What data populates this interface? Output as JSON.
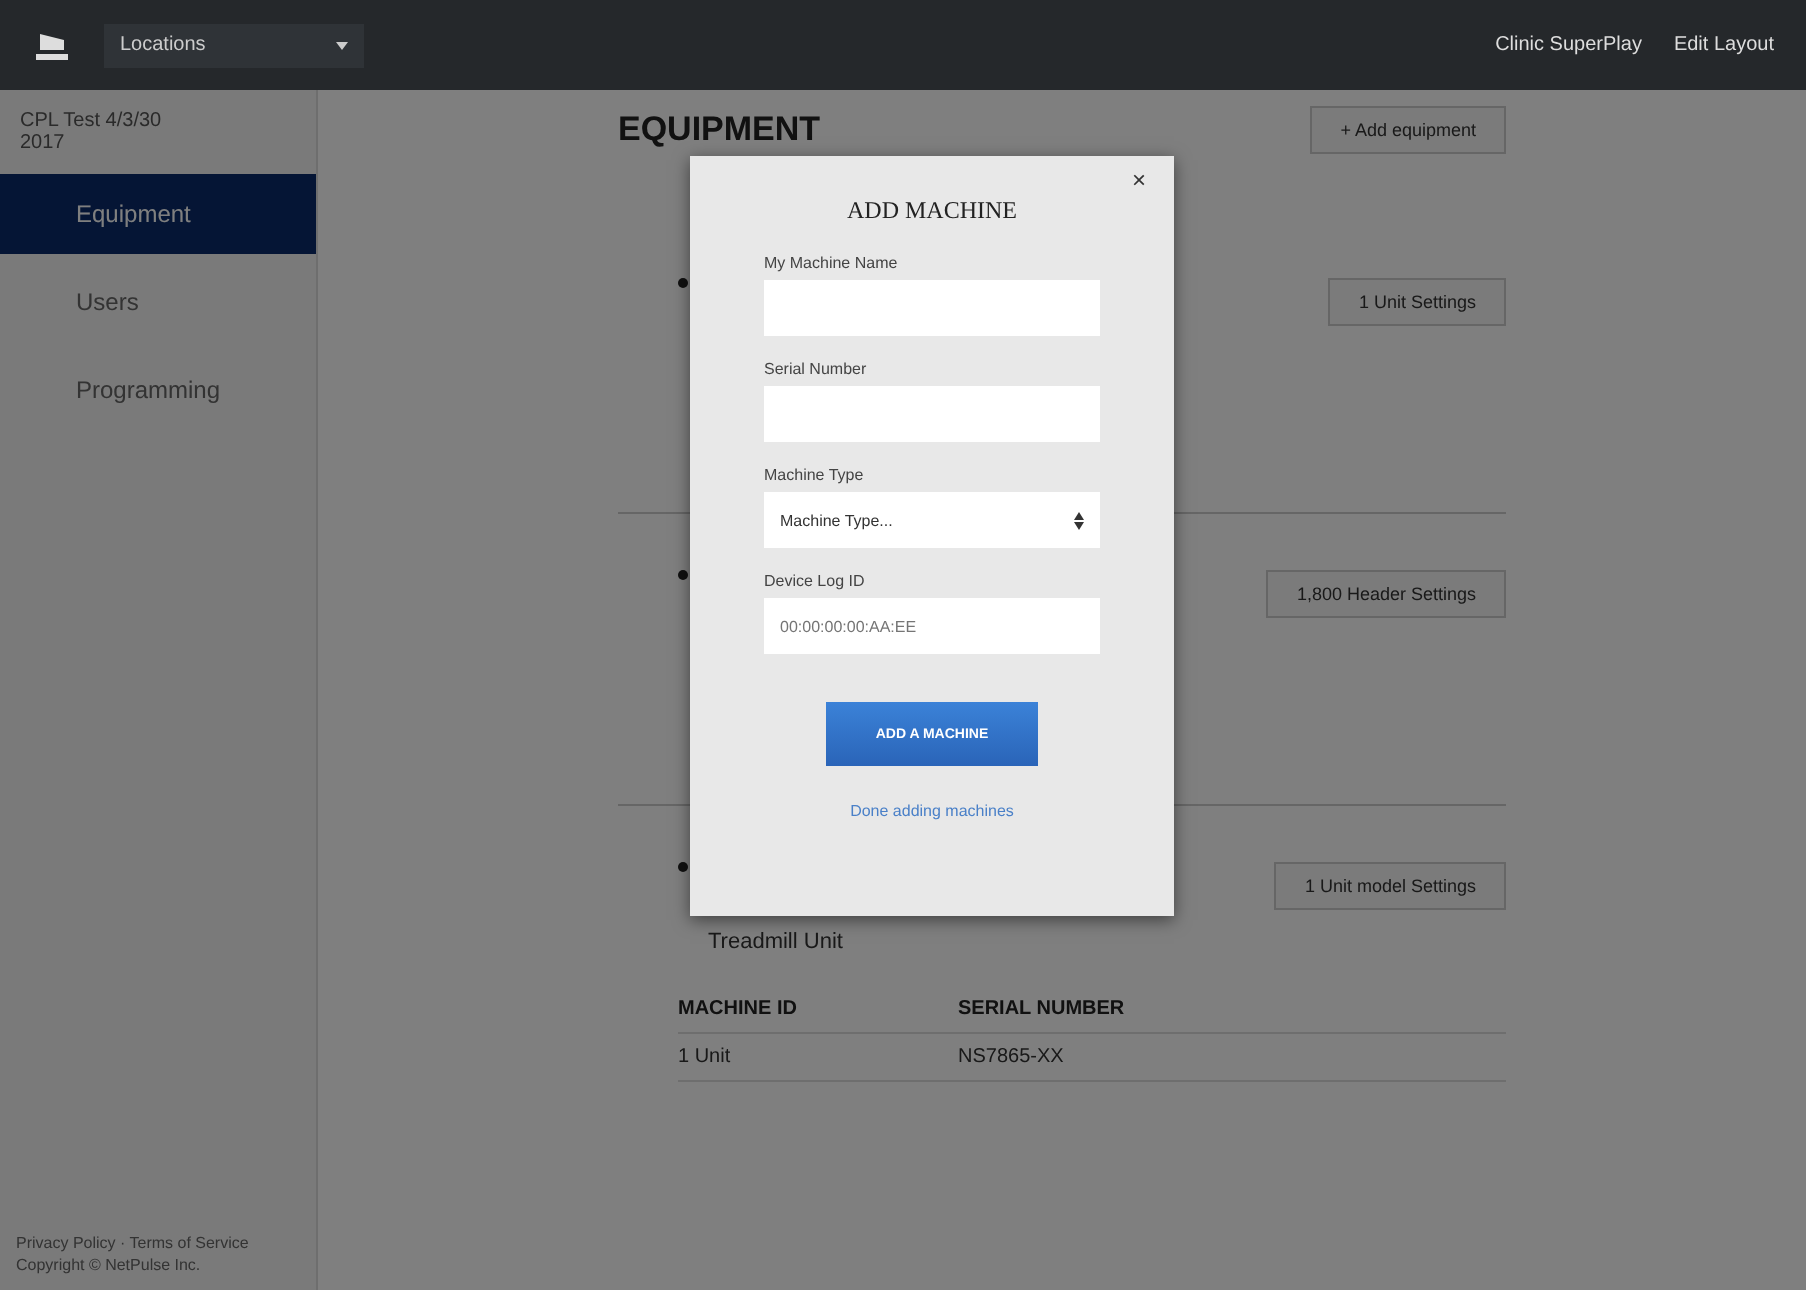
{
  "topbar": {
    "location_menu": "Locations",
    "links": [
      "Clinic SuperPlay",
      "Edit Layout"
    ]
  },
  "sidebar": {
    "account": "CPL Test 4/3/30",
    "account_sub": "2017",
    "items": [
      {
        "label": "Equipment",
        "selected": true
      },
      {
        "label": "Users",
        "selected": false
      },
      {
        "label": "Programming",
        "selected": false
      }
    ],
    "footer": [
      "Privacy Policy · Terms of Service",
      "Copyright © NetPulse Inc."
    ]
  },
  "main": {
    "title": "EQUIPMENT",
    "add_button": "+ Add equipment",
    "sections": [
      {
        "settings_button": "1 Unit Settings"
      },
      {
        "settings_button": "1,800 Header Settings"
      },
      {
        "name": "Treadmill Unit",
        "settings_button": "1 Unit model Settings"
      }
    ],
    "table": {
      "columns": [
        "MACHINE ID",
        "SERIAL NUMBER"
      ],
      "rows": [
        [
          "1 Unit",
          "NS7865-XX"
        ]
      ]
    }
  },
  "modal": {
    "title": "ADD MACHINE",
    "close": "×",
    "fields": [
      {
        "kind": "text",
        "label": "My Machine Name"
      },
      {
        "kind": "text",
        "label": "Serial Number"
      },
      {
        "kind": "select",
        "label": "Machine Type",
        "value": "Machine Type..."
      },
      {
        "kind": "text",
        "label": "Device Log ID",
        "placeholder": "00:00:00:00:AA:EE"
      }
    ],
    "submit": "ADD A MACHINE",
    "done_link": "Done adding machines"
  }
}
